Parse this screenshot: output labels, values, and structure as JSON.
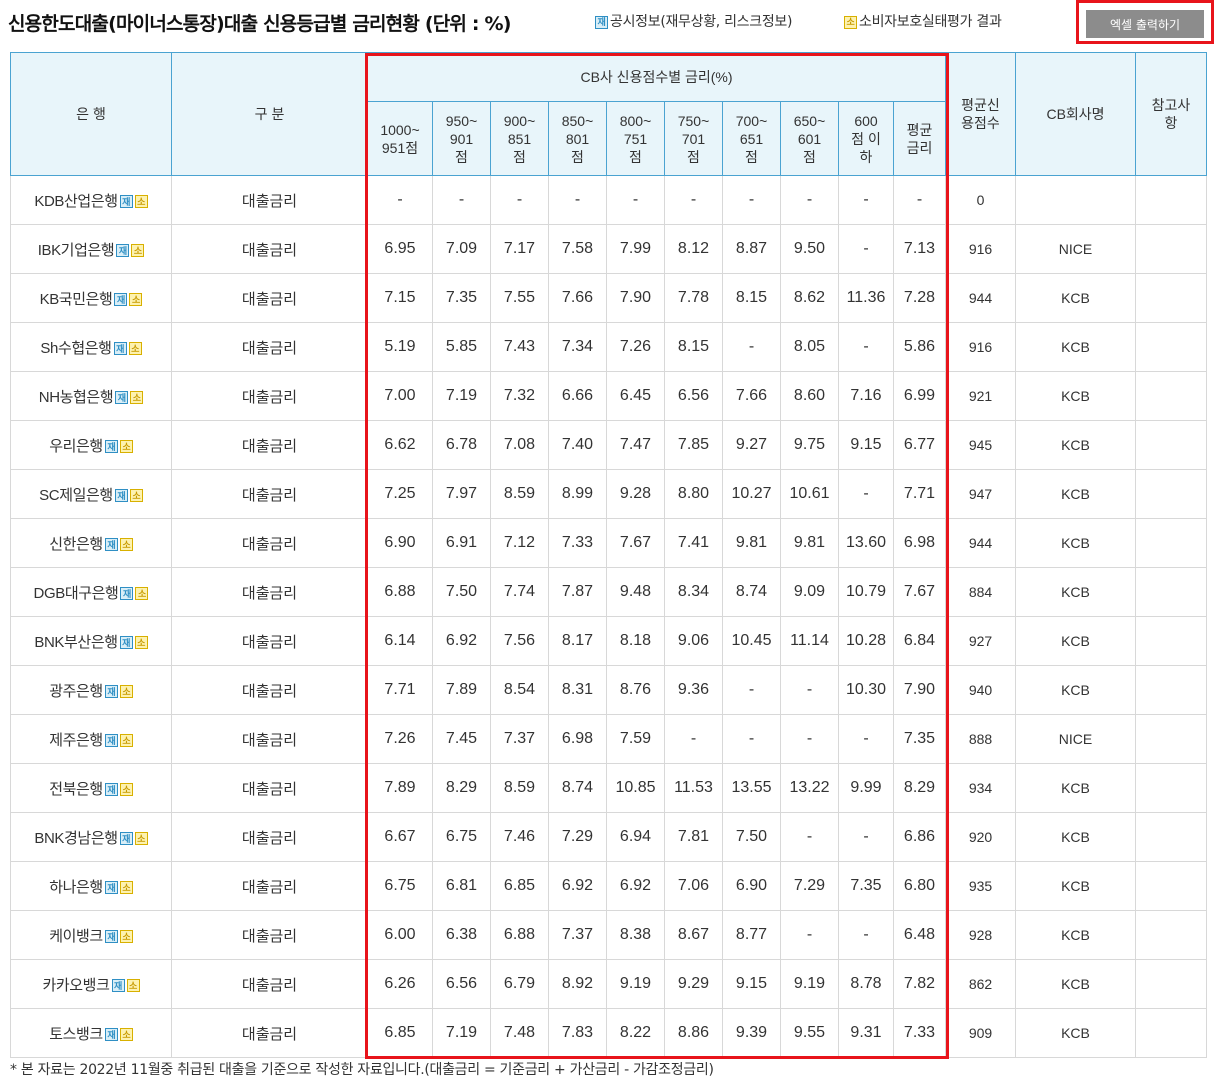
{
  "header": {
    "title": "신용한도대출(마이너스통장)대출 신용등급별 금리현황 (단위 : %)",
    "legend_disclosure_badge": "재",
    "legend_disclosure_text": "공시정보(재무상황, 리스크정보)",
    "legend_consumer_badge": "소",
    "legend_consumer_text": "소비자보호실태평가 결과",
    "excel_button": "엑셀 출력하기"
  },
  "table": {
    "col_bank": "은 행",
    "col_type": "구 분",
    "col_group": "CB사 신용점수별 금리(%)",
    "score_ranges": [
      "1000~\n951점",
      "950~\n901\n점",
      "900~\n851\n점",
      "850~\n801\n점",
      "800~\n751\n점",
      "750~\n701\n점",
      "700~\n651\n점",
      "650~\n601\n점",
      "600\n점 이\n하",
      "평균\n금리"
    ],
    "col_avg_score": "평균신\n용점수",
    "col_cb": "CB회사명",
    "col_note": "참고사\n항",
    "badge_jae": "재",
    "badge_so": "소",
    "rows": [
      {
        "bank": "KDB산업은행",
        "type": "대출금리",
        "rates": [
          "-",
          "-",
          "-",
          "-",
          "-",
          "-",
          "-",
          "-",
          "-",
          "-"
        ],
        "avg_score": "0",
        "cb": "",
        "note": ""
      },
      {
        "bank": "IBK기업은행",
        "type": "대출금리",
        "rates": [
          "6.95",
          "7.09",
          "7.17",
          "7.58",
          "7.99",
          "8.12",
          "8.87",
          "9.50",
          "-",
          "7.13"
        ],
        "avg_score": "916",
        "cb": "NICE",
        "note": ""
      },
      {
        "bank": "KB국민은행",
        "type": "대출금리",
        "rates": [
          "7.15",
          "7.35",
          "7.55",
          "7.66",
          "7.90",
          "7.78",
          "8.15",
          "8.62",
          "11.36",
          "7.28"
        ],
        "avg_score": "944",
        "cb": "KCB",
        "note": ""
      },
      {
        "bank": "Sh수협은행",
        "type": "대출금리",
        "rates": [
          "5.19",
          "5.85",
          "7.43",
          "7.34",
          "7.26",
          "8.15",
          "-",
          "8.05",
          "-",
          "5.86"
        ],
        "avg_score": "916",
        "cb": "KCB",
        "note": ""
      },
      {
        "bank": "NH농협은행",
        "type": "대출금리",
        "rates": [
          "7.00",
          "7.19",
          "7.32",
          "6.66",
          "6.45",
          "6.56",
          "7.66",
          "8.60",
          "7.16",
          "6.99"
        ],
        "avg_score": "921",
        "cb": "KCB",
        "note": ""
      },
      {
        "bank": "우리은행",
        "type": "대출금리",
        "rates": [
          "6.62",
          "6.78",
          "7.08",
          "7.40",
          "7.47",
          "7.85",
          "9.27",
          "9.75",
          "9.15",
          "6.77"
        ],
        "avg_score": "945",
        "cb": "KCB",
        "note": ""
      },
      {
        "bank": "SC제일은행",
        "type": "대출금리",
        "rates": [
          "7.25",
          "7.97",
          "8.59",
          "8.99",
          "9.28",
          "8.80",
          "10.27",
          "10.61",
          "-",
          "7.71"
        ],
        "avg_score": "947",
        "cb": "KCB",
        "note": ""
      },
      {
        "bank": "신한은행",
        "type": "대출금리",
        "rates": [
          "6.90",
          "6.91",
          "7.12",
          "7.33",
          "7.67",
          "7.41",
          "9.81",
          "9.81",
          "13.60",
          "6.98"
        ],
        "avg_score": "944",
        "cb": "KCB",
        "note": ""
      },
      {
        "bank": "DGB대구은행",
        "type": "대출금리",
        "rates": [
          "6.88",
          "7.50",
          "7.74",
          "7.87",
          "9.48",
          "8.34",
          "8.74",
          "9.09",
          "10.79",
          "7.67"
        ],
        "avg_score": "884",
        "cb": "KCB",
        "note": ""
      },
      {
        "bank": "BNK부산은행",
        "type": "대출금리",
        "rates": [
          "6.14",
          "6.92",
          "7.56",
          "8.17",
          "8.18",
          "9.06",
          "10.45",
          "11.14",
          "10.28",
          "6.84"
        ],
        "avg_score": "927",
        "cb": "KCB",
        "note": ""
      },
      {
        "bank": "광주은행",
        "type": "대출금리",
        "rates": [
          "7.71",
          "7.89",
          "8.54",
          "8.31",
          "8.76",
          "9.36",
          "-",
          "-",
          "10.30",
          "7.90"
        ],
        "avg_score": "940",
        "cb": "KCB",
        "note": ""
      },
      {
        "bank": "제주은행",
        "type": "대출금리",
        "rates": [
          "7.26",
          "7.45",
          "7.37",
          "6.98",
          "7.59",
          "-",
          "-",
          "-",
          "-",
          "7.35"
        ],
        "avg_score": "888",
        "cb": "NICE",
        "note": ""
      },
      {
        "bank": "전북은행",
        "type": "대출금리",
        "rates": [
          "7.89",
          "8.29",
          "8.59",
          "8.74",
          "10.85",
          "11.53",
          "13.55",
          "13.22",
          "9.99",
          "8.29"
        ],
        "avg_score": "934",
        "cb": "KCB",
        "note": ""
      },
      {
        "bank": "BNK경남은행",
        "type": "대출금리",
        "rates": [
          "6.67",
          "6.75",
          "7.46",
          "7.29",
          "6.94",
          "7.81",
          "7.50",
          "-",
          "-",
          "6.86"
        ],
        "avg_score": "920",
        "cb": "KCB",
        "note": ""
      },
      {
        "bank": "하나은행",
        "type": "대출금리",
        "rates": [
          "6.75",
          "6.81",
          "6.85",
          "6.92",
          "6.92",
          "7.06",
          "6.90",
          "7.29",
          "7.35",
          "6.80"
        ],
        "avg_score": "935",
        "cb": "KCB",
        "note": ""
      },
      {
        "bank": "케이뱅크",
        "type": "대출금리",
        "rates": [
          "6.00",
          "6.38",
          "6.88",
          "7.37",
          "8.38",
          "8.67",
          "8.77",
          "-",
          "-",
          "6.48"
        ],
        "avg_score": "928",
        "cb": "KCB",
        "note": ""
      },
      {
        "bank": "카카오뱅크",
        "type": "대출금리",
        "rates": [
          "6.26",
          "6.56",
          "6.79",
          "8.92",
          "9.19",
          "9.29",
          "9.15",
          "9.19",
          "8.78",
          "7.82"
        ],
        "avg_score": "862",
        "cb": "KCB",
        "note": ""
      },
      {
        "bank": "토스뱅크",
        "type": "대출금리",
        "rates": [
          "6.85",
          "7.19",
          "7.48",
          "7.83",
          "8.22",
          "8.86",
          "9.39",
          "9.55",
          "9.31",
          "7.33"
        ],
        "avg_score": "909",
        "cb": "KCB",
        "note": ""
      }
    ]
  },
  "footnote": "* 본 자료는 2022년 11월중 취급된 대출을 기준으로 작성한 자료입니다.(대출금리 = 기준금리 + 가산금리 - 가감조정금리)",
  "colors": {
    "header_bg": "#e8f5fa",
    "header_border": "#4aa3d1",
    "highlight": "#e8141b",
    "button_bg": "#8c8c8c"
  }
}
